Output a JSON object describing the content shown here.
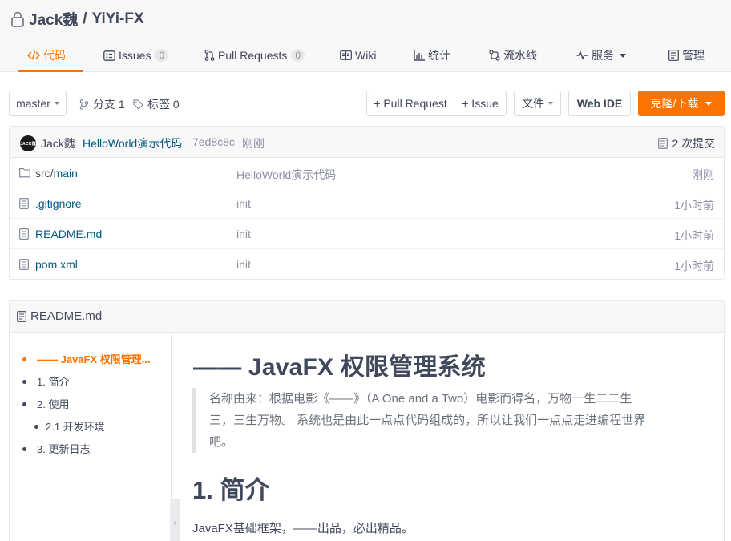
{
  "repo": {
    "owner": "Jack魏",
    "separator": "/",
    "name": "YiYi-FX"
  },
  "tabs": [
    {
      "icon": "code-icon",
      "label": "代码"
    },
    {
      "icon": "issues-icon",
      "label": "Issues",
      "count": "0"
    },
    {
      "icon": "pull-request-icon",
      "label": "Pull Requests",
      "count": "0"
    },
    {
      "icon": "wiki-icon",
      "label": "Wiki"
    },
    {
      "icon": "stats-icon",
      "label": "统计"
    },
    {
      "icon": "pipeline-icon",
      "label": "流水线"
    },
    {
      "icon": "service-icon",
      "label": "服务"
    },
    {
      "icon": "manage-icon",
      "label": "管理"
    }
  ],
  "toolbar": {
    "branch": "master",
    "branches_label": "分支 1",
    "tags_label": "标签 0",
    "new_pr": "+ Pull Request",
    "new_issue": "+ Issue",
    "file_menu": "文件",
    "web_ide": "Web IDE",
    "clone": "克隆/下载"
  },
  "commit": {
    "avatar_text": "JACK魏",
    "author": "Jack魏",
    "message": "HelloWorld演示代码",
    "sha": "7ed8c8c",
    "time": "刚刚",
    "count": "2 次提交"
  },
  "files": [
    {
      "type": "folder",
      "dir": "src/",
      "name": "main",
      "message": "HelloWorld演示代码",
      "time": "刚刚"
    },
    {
      "type": "file",
      "dir": "",
      "name": ".gitignore",
      "message": "init",
      "time": "1小时前"
    },
    {
      "type": "file",
      "dir": "",
      "name": "README.md",
      "message": "init",
      "time": "1小时前"
    },
    {
      "type": "file",
      "dir": "",
      "name": "pom.xml",
      "message": "init",
      "time": "1小时前"
    }
  ],
  "readme": {
    "filename": "README.md",
    "toc": [
      {
        "label": "—— JavaFX 权限管理..."
      },
      {
        "label": "1. 简介"
      },
      {
        "label": "2. 使用"
      },
      {
        "label": "2.1 开发环境"
      },
      {
        "label": "3. 更新日志"
      }
    ],
    "h1": "—— JavaFX 权限管理系统",
    "quote_line1": "名称由来：根据电影《——》（A One and a Two）电影而得名，万物一生二二生",
    "quote_line2": "三，三生万物。 系统也是由此一点点代码组成的，所以让我们一点点走进编程世界",
    "quote_line3": "吧。",
    "h2": "1. 简介",
    "para": "JavaFX基础框架，——出品，必出精品。"
  },
  "colors": {
    "accent": "#fe7300",
    "link": "#005980",
    "text": "#40485b",
    "muted": "#8c92a4"
  }
}
